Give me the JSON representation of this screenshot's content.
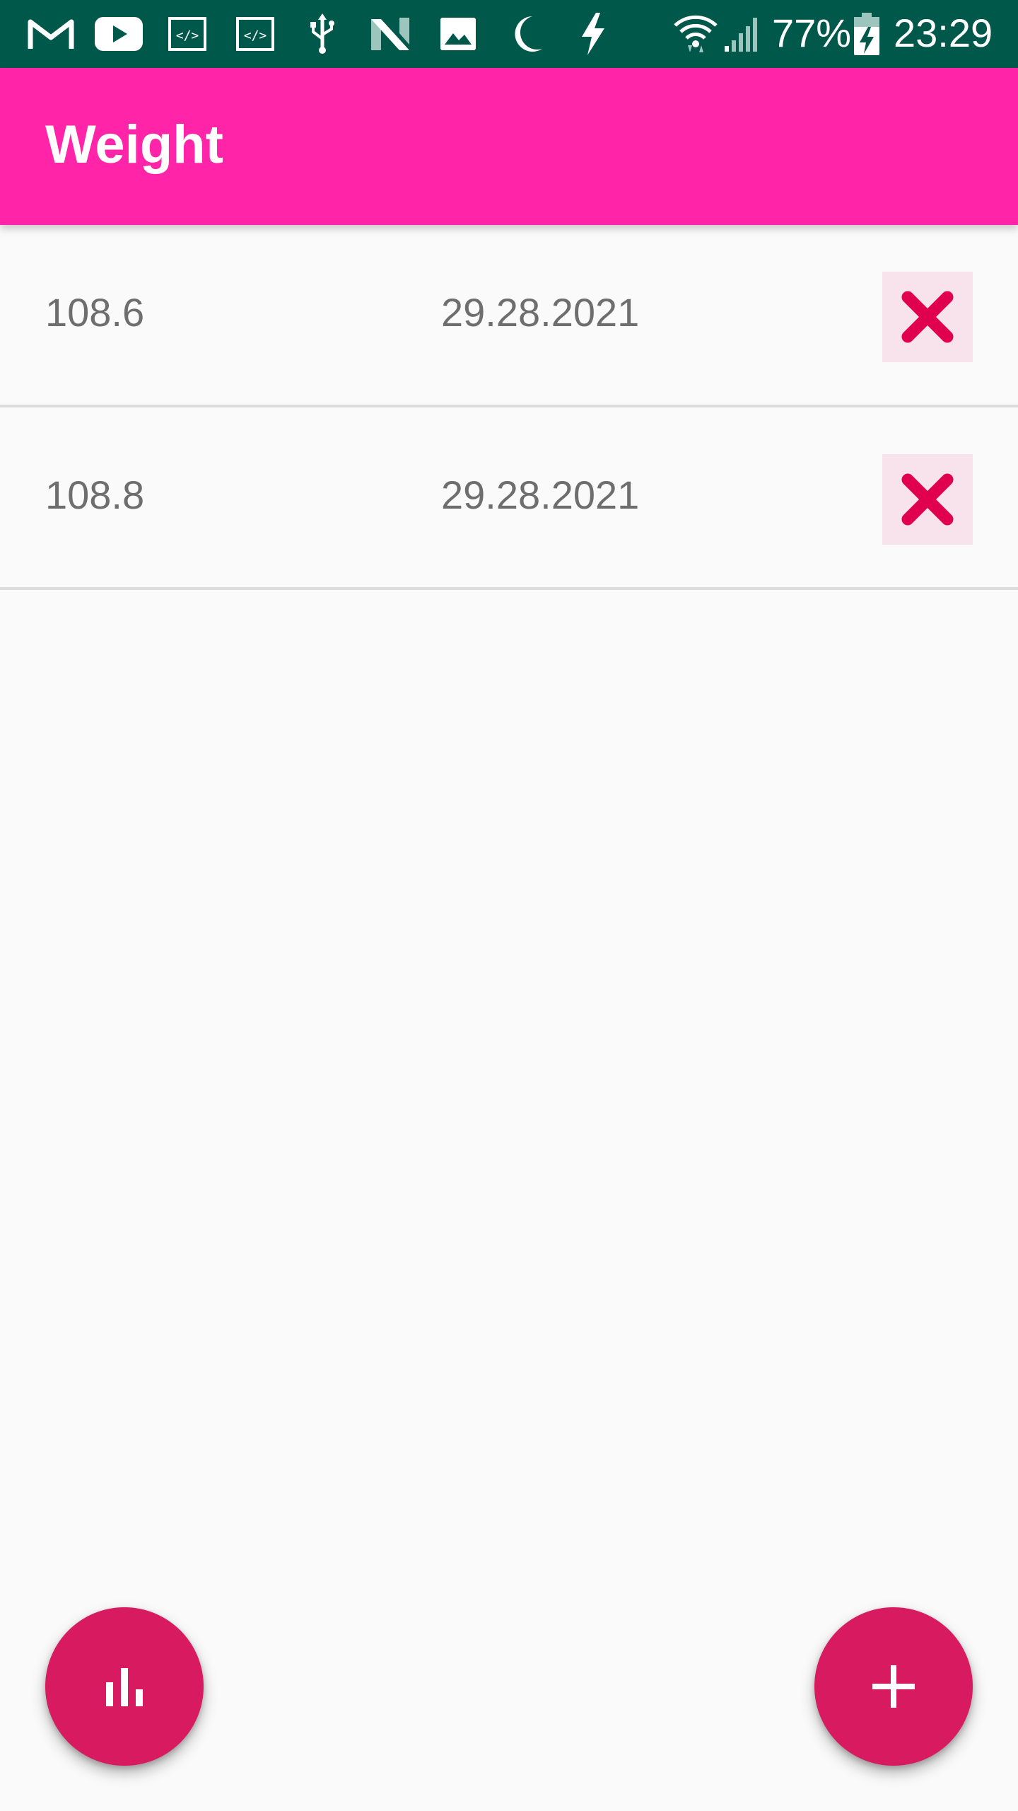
{
  "status_bar": {
    "battery_percent": "77%",
    "time": "23:29",
    "icons": [
      "gmail-icon",
      "youtube-icon",
      "code-icon",
      "code-icon",
      "usb-icon",
      "n-icon",
      "image-icon",
      "moon-icon",
      "flash-icon",
      "wifi-icon",
      "signal-icon",
      "battery-charging-icon"
    ]
  },
  "app_bar": {
    "title": "Weight"
  },
  "entries": [
    {
      "weight": "108.6",
      "date": "29.28.2021"
    },
    {
      "weight": "108.8",
      "date": "29.28.2021"
    }
  ],
  "fabs": {
    "chart_icon": "bar-chart-icon",
    "add_icon": "plus-icon"
  },
  "colors": {
    "status_bar": "#00584b",
    "app_bar": "#ff24a8",
    "fab": "#d81b60",
    "delete_x": "#e0004d",
    "delete_bg": "#f8e3ec",
    "list_text": "#6e6e6e"
  }
}
